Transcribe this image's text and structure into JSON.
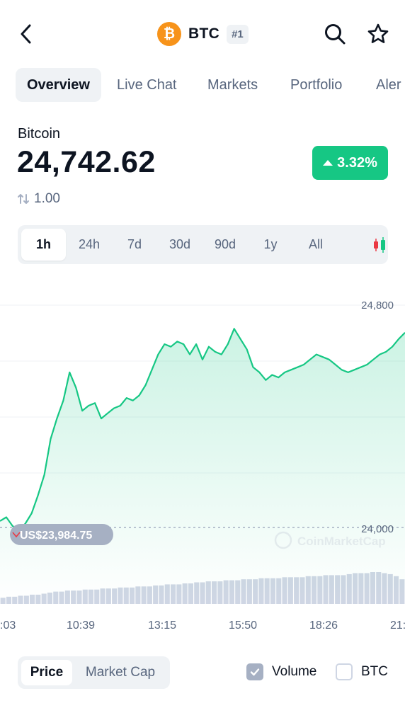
{
  "header": {
    "back_icon": "chevron-left-icon",
    "coin_symbol_glyph": "₿",
    "ticker": "BTC",
    "rank": "#1",
    "search_icon": "search-icon",
    "star_icon": "star-icon"
  },
  "tabs": [
    {
      "label": "Overview",
      "active": true
    },
    {
      "label": "Live Chat",
      "active": false
    },
    {
      "label": "Markets",
      "active": false
    },
    {
      "label": "Portfolio",
      "active": false
    },
    {
      "label": "Aler",
      "active": false
    }
  ],
  "coin": {
    "name": "Bitcoin",
    "price": "24,742.62",
    "change": "3.32%",
    "change_direction": "up",
    "ratio": "1.00"
  },
  "time_ranges": [
    {
      "label": "1h",
      "active": true
    },
    {
      "label": "24h",
      "active": false
    },
    {
      "label": "7d",
      "active": false
    },
    {
      "label": "30d",
      "active": false
    },
    {
      "label": "90d",
      "active": false
    },
    {
      "label": "1y",
      "active": false
    },
    {
      "label": "All",
      "active": false
    }
  ],
  "chart_type_icon": "candlestick-icon",
  "chart_labels": {
    "y_top": "24,800",
    "y_bottom": "24,000",
    "start_price": "US$23,984.75",
    "watermark": "CoinMarketCap",
    "x_ticks": [
      ":03",
      "10:39",
      "13:15",
      "15:50",
      "18:26",
      "21:"
    ]
  },
  "chart_data": {
    "type": "area",
    "series": [
      {
        "values": [
          24010,
          24025,
          23990,
          23975,
          24000,
          24040,
          24110,
          24190,
          24330,
          24410,
          24480,
          24590,
          24530,
          24440,
          24460,
          24470,
          24410,
          24430,
          24450,
          24460,
          24490,
          24480,
          24500,
          24540,
          24600,
          24660,
          24700,
          24690,
          24710,
          24700,
          24660,
          24700,
          24640,
          24690,
          24670,
          24660,
          24700,
          24760,
          24720,
          24680,
          24610,
          24590,
          24560,
          24580,
          24570,
          24590,
          24600,
          24610,
          24620,
          24640,
          24660,
          24650,
          24640,
          24620,
          24600,
          24590,
          24600,
          24610,
          24620,
          24640,
          24660,
          24670,
          24690,
          24720,
          24745
        ]
      }
    ],
    "reference_line": 23984.75,
    "ylim": [
      23960,
      24830
    ],
    "volume": [
      6,
      7,
      7,
      8,
      8,
      9,
      9,
      10,
      11,
      12,
      12,
      13,
      13,
      13,
      14,
      14,
      14,
      15,
      15,
      15,
      16,
      16,
      16,
      17,
      17,
      17,
      18,
      18,
      19,
      19,
      19,
      20,
      20,
      21,
      21,
      22,
      22,
      22,
      23,
      23,
      23,
      24,
      24,
      24,
      25,
      25,
      25,
      25,
      26,
      26,
      26,
      26,
      27,
      27,
      27,
      28,
      28,
      28,
      28,
      29,
      30,
      30,
      30,
      31,
      31,
      30,
      29,
      27,
      24
    ],
    "xlabel": "",
    "ylabel": ""
  },
  "bottom": {
    "toggle": [
      {
        "label": "Price",
        "active": true
      },
      {
        "label": "Market Cap",
        "active": false
      }
    ],
    "volume": {
      "label": "Volume",
      "checked": true
    },
    "btc": {
      "label": "BTC",
      "checked": false
    }
  },
  "colors": {
    "accent_green": "#16c784",
    "bitcoin_orange": "#f7931a",
    "muted_text": "#58667e",
    "surface_gray": "#eff2f5"
  }
}
